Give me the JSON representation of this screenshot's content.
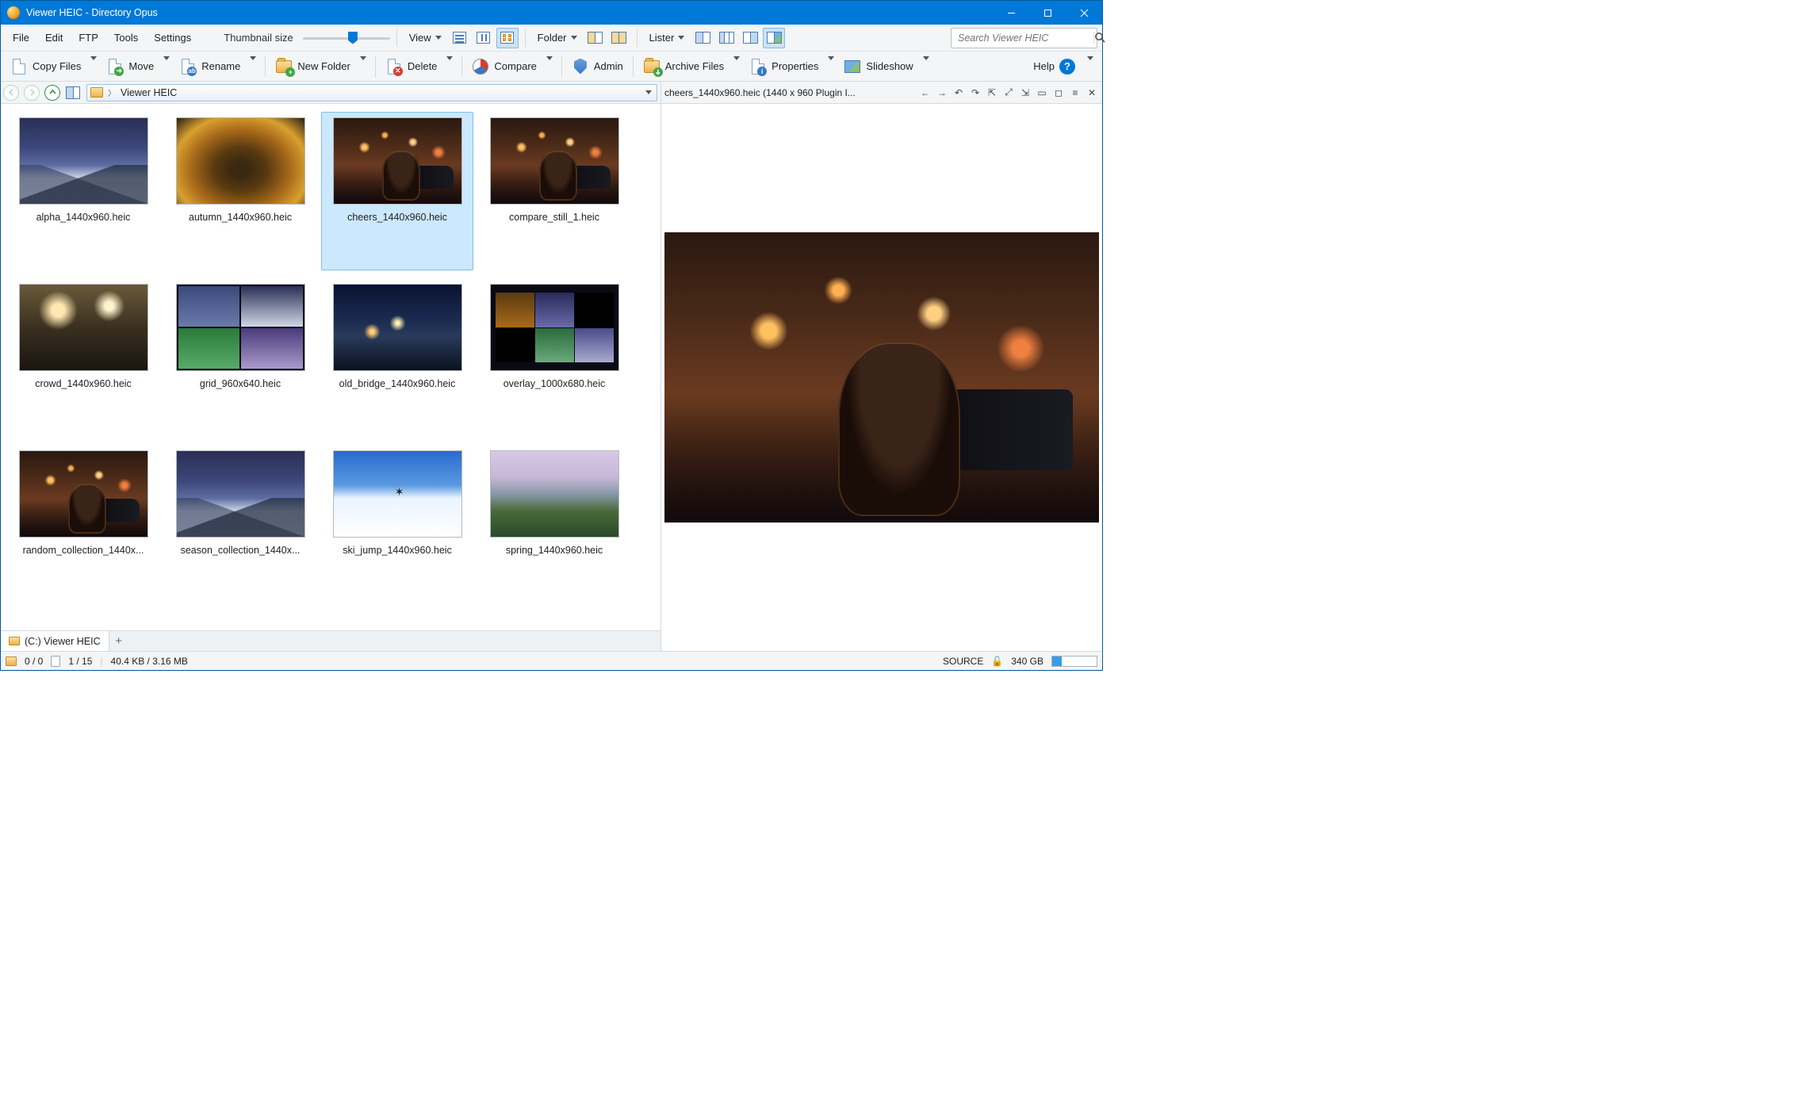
{
  "titlebar": {
    "title": "Viewer HEIC - Directory Opus"
  },
  "menubar": {
    "items": [
      "File",
      "Edit",
      "FTP",
      "Tools",
      "Settings"
    ],
    "thumb_label": "Thumbnail size",
    "view_label": "View",
    "folder_label": "Folder",
    "lister_label": "Lister",
    "search_placeholder": "Search Viewer HEIC"
  },
  "toolbar": {
    "copy": "Copy Files",
    "move": "Move",
    "rename": "Rename",
    "newfolder": "New Folder",
    "delete": "Delete",
    "compare": "Compare",
    "admin": "Admin",
    "archive": "Archive Files",
    "properties": "Properties",
    "slideshow": "Slideshow",
    "help": "Help"
  },
  "location": {
    "current": "Viewer HEIC"
  },
  "preview_info": "cheers_1440x960.heic (1440 x 960 Plugin I...",
  "files": [
    {
      "name": "alpha_1440x960.heic",
      "style": "ph-mountain-snow",
      "selected": false
    },
    {
      "name": "autumn_1440x960.heic",
      "style": "ph-autumn",
      "selected": false
    },
    {
      "name": "cheers_1440x960.heic",
      "style": "ph-city-night",
      "selected": true
    },
    {
      "name": "compare_still_1.heic",
      "style": "ph-city-night",
      "selected": false
    },
    {
      "name": "crowd_1440x960.heic",
      "style": "ph-crowd",
      "selected": false
    },
    {
      "name": "grid_960x640.heic",
      "style": "ph-grid",
      "selected": false
    },
    {
      "name": "old_bridge_1440x960.heic",
      "style": "ph-bridge",
      "selected": false
    },
    {
      "name": "overlay_1000x680.heic",
      "style": "ph-overlay",
      "selected": false
    },
    {
      "name": "random_collection_1440x...",
      "style": "ph-city-night",
      "selected": false
    },
    {
      "name": "season_collection_1440x...",
      "style": "ph-mountain-snow",
      "selected": false
    },
    {
      "name": "ski_jump_1440x960.heic",
      "style": "ph-skijump",
      "selected": false
    },
    {
      "name": "spring_1440x960.heic",
      "style": "ph-spring",
      "selected": false
    }
  ],
  "tabs": {
    "label": "(C:) Viewer HEIC"
  },
  "status": {
    "hidden": "0 / 0",
    "count": "1 / 15",
    "size": "40.4 KB / 3.16 MB",
    "source": "SOURCE",
    "disk": "340 GB"
  }
}
